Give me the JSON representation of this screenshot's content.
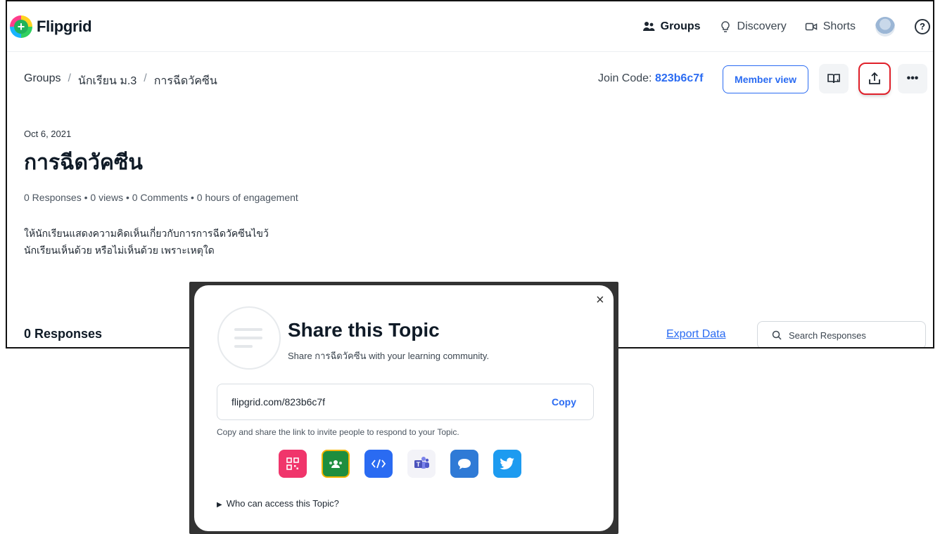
{
  "header": {
    "app_name": "Flipgrid",
    "nav": [
      {
        "label": "Groups",
        "icon": "groups-icon",
        "active": true
      },
      {
        "label": "Discovery",
        "icon": "lightbulb-icon",
        "active": false
      },
      {
        "label": "Shorts",
        "icon": "video-camera-icon",
        "active": false
      }
    ],
    "help_glyph": "?"
  },
  "breadcrumb": [
    "Groups",
    "นักเรียน ม.3",
    "การฉีดวัคซีน"
  ],
  "breadcrumb_sep": "/",
  "toolbar": {
    "join_label": "Join Code:",
    "join_code": "823b6c7f",
    "member_view_label": "Member view",
    "more_glyph": "•••"
  },
  "topic": {
    "date": "Oct 6, 2021",
    "title": "การฉีดวัคซีน",
    "stats": "0 Responses • 0 views • 0 Comments • 0 hours of engagement",
    "description_lines": [
      "ให้นักเรียนแสดงความคิดเห็นเกี่ยวกับการการฉีดวัคซีนไขว้",
      "นักเรียนเห็นด้วย หรือไม่เห็นด้วย เพราะเหตุใด"
    ]
  },
  "responses": {
    "heading": "0 Responses",
    "export_label": "Export Data",
    "search_placeholder": "Search Responses"
  },
  "share_modal": {
    "close_glyph": "×",
    "title": "Share this Topic",
    "subtitle": "Share การฉีดวัคซีน with your learning community.",
    "link": "flipgrid.com/823b6c7f",
    "copy_label": "Copy",
    "hint": "Copy and share the link to invite people to respond to your Topic.",
    "share_options": [
      {
        "name": "qr-code",
        "icon": "qr-code-icon",
        "color": "#f0356b"
      },
      {
        "name": "google-classroom",
        "icon": "google-classroom-icon",
        "color": "#1e8e3e"
      },
      {
        "name": "embed",
        "icon": "embed-code-icon",
        "color": "#2a6bf2"
      },
      {
        "name": "microsoft-teams",
        "icon": "microsoft-teams-icon",
        "color": "#f3f3f8"
      },
      {
        "name": "remind",
        "icon": "remind-chat-icon",
        "color": "#2f7ad6"
      },
      {
        "name": "twitter",
        "icon": "twitter-icon",
        "color": "#1d9bf0"
      }
    ],
    "access_label": "Who can access this Topic?"
  }
}
